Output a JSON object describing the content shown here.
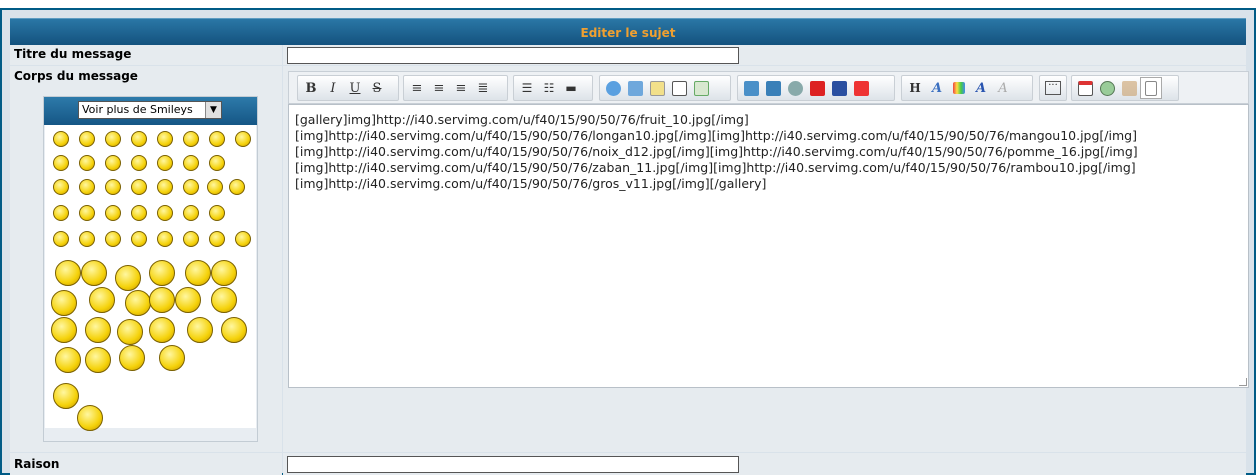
{
  "form": {
    "title": "Editer le sujet",
    "subject_label": "Titre du message",
    "subject_value": "",
    "body_label": "Corps du message",
    "reason_label": "Raison",
    "reason_value": ""
  },
  "smileys": {
    "select_label": "Voir plus de Smileys"
  },
  "toolbar": {
    "bold": "B",
    "italic": "I",
    "underline": "U",
    "strike": "S",
    "heading": "H"
  },
  "editor": {
    "lines": [
      "[gallery]img]http://i40.servimg.com/u/f40/15/90/50/76/fruit_10.jpg[/img]",
      "[img]http://i40.servimg.com/u/f40/15/90/50/76/longan10.jpg[/img][img]http://i40.servimg.com/u/f40/15/90/50/76/mangou10.jpg[/img]",
      "[img]http://i40.servimg.com/u/f40/15/90/50/76/noix_d12.jpg[/img][img]http://i40.servimg.com/u/f40/15/90/50/76/pomme_16.jpg[/img]",
      "[img]http://i40.servimg.com/u/f40/15/90/50/76/zaban_11.jpg[/img][img]http://i40.servimg.com/u/f40/15/90/50/76/rambou10.jpg[/img]",
      "[img]http://i40.servimg.com/u/f40/15/90/50/76/gros_v11.jpg[/img][/gallery]"
    ]
  },
  "colors": {
    "header_text": "#f0a030",
    "header_bg": "#1d6494",
    "frame_border": "#005b86"
  }
}
